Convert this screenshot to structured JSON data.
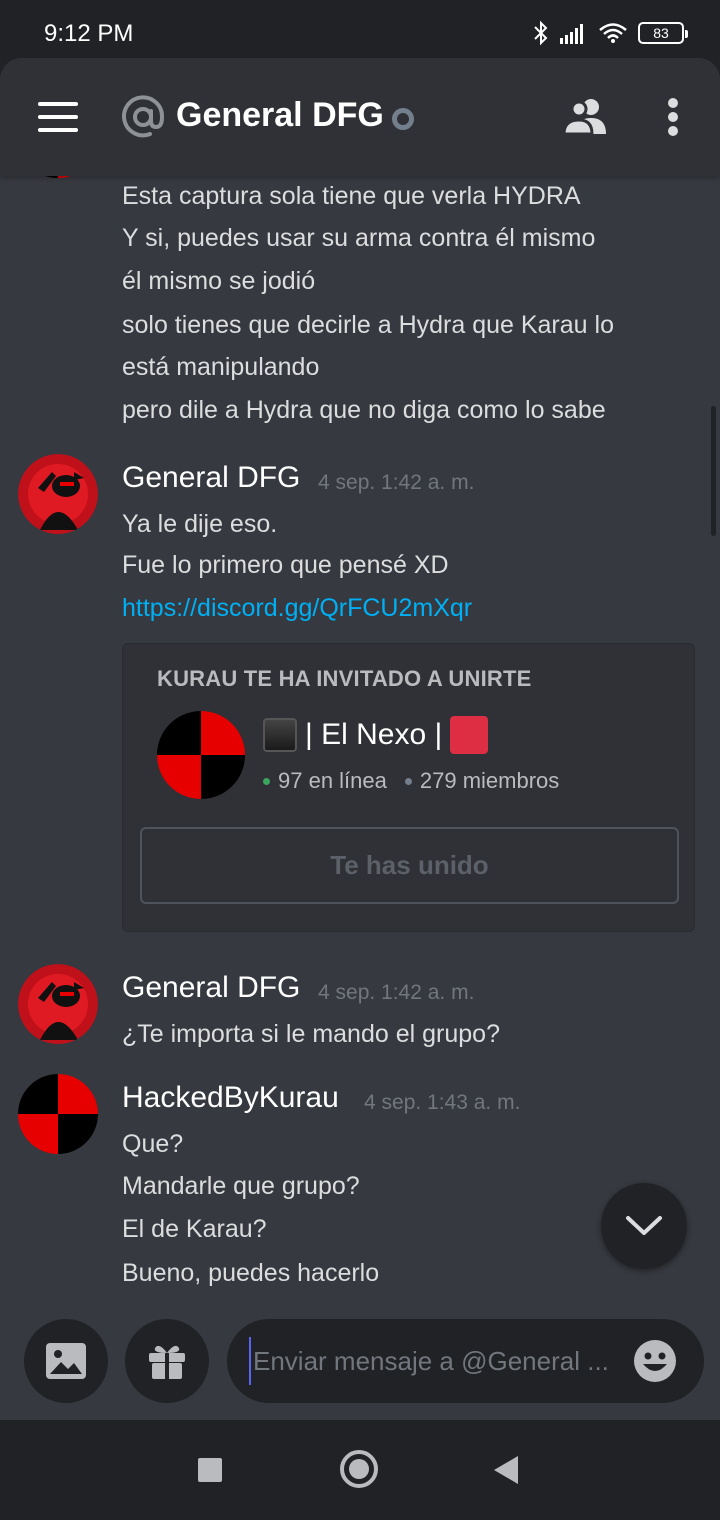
{
  "status_bar": {
    "time": "9:12 PM",
    "battery": "83"
  },
  "header": {
    "title": "General DFG"
  },
  "messages": [
    {
      "id": "prev",
      "lines": [
        "Esta captura sola tiene que verla HYDRA",
        "Y si, puedes usar su arma contra él mismo",
        "él mismo se jodió",
        "solo tienes que decirle a Hydra que Karau lo",
        "está manipulando",
        "pero dile a Hydra que no diga como lo sabe"
      ]
    },
    {
      "id": "m1",
      "author": "General DFG",
      "timestamp": "4 sep. 1:42 a. m.",
      "lines": [
        "Ya le dije eso.",
        "Fue lo primero que pensé XD"
      ],
      "link": "https://discord.gg/QrFCU2mXqr"
    },
    {
      "id": "m2",
      "author": "General DFG",
      "timestamp": "4 sep. 1:42 a. m.",
      "lines": [
        "¿Te importa si le mando el grupo?"
      ]
    },
    {
      "id": "m3",
      "author": "HackedByKurau",
      "timestamp": "4 sep. 1:43 a. m.",
      "lines": [
        "Que?",
        "Mandarle que grupo?",
        "El de Karau?",
        "Bueno, puedes hacerlo"
      ]
    }
  ],
  "invite": {
    "heading": "KURAU TE HA INVITADO A UNIRTE",
    "guild_name": "| El Nexo |",
    "online": "97 en línea",
    "members": "279 miembros",
    "button_label": "Te has unido",
    "online_color": "#3ba55d",
    "members_color": "#747f8d"
  },
  "composer": {
    "placeholder": "Enviar mensaje a @General ..."
  },
  "icons": {
    "menu": "hamburger-icon",
    "at": "at-sign-icon",
    "members": "members-icon",
    "more": "more-vertical-icon",
    "jump": "chevron-down-icon",
    "image": "image-icon",
    "gift": "gift-icon",
    "emoji": "emoji-icon"
  },
  "colors": {
    "background": "#36393f",
    "header": "#2f3136",
    "link": "#00b0f4",
    "avatar_red": "#e60000"
  }
}
